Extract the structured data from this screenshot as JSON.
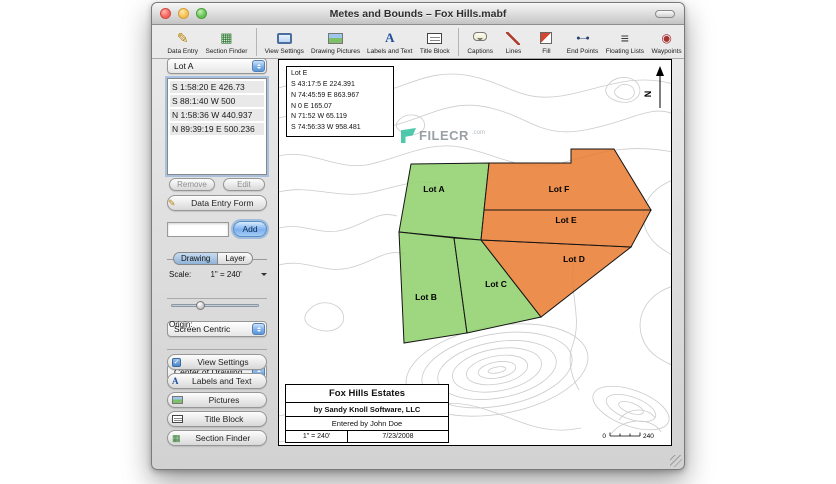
{
  "window": {
    "title": "Metes and Bounds – Fox Hills.mabf"
  },
  "toolbar": {
    "items": [
      {
        "label": "Data Entry",
        "icon": "pencil-icon"
      },
      {
        "label": "Section Finder",
        "icon": "grid-icon"
      },
      {
        "label": "View Settings",
        "icon": "monitor-icon"
      },
      {
        "label": "Drawing Pictures",
        "icon": "picture-icon"
      },
      {
        "label": "Labels and Text",
        "icon": "letter-a-icon"
      },
      {
        "label": "Title Block",
        "icon": "title-block-icon"
      },
      {
        "label": "Captions",
        "icon": "speech-bubble-icon"
      },
      {
        "label": "Lines",
        "icon": "diagonal-line-icon"
      },
      {
        "label": "Fill",
        "icon": "fill-icon"
      },
      {
        "label": "End Points",
        "icon": "end-points-icon"
      },
      {
        "label": "Floating Lists",
        "icon": "list-icon"
      },
      {
        "label": "Waypoints",
        "icon": "waypoint-icon"
      }
    ]
  },
  "sidebar": {
    "lot_popup_value": "Lot A",
    "calls": [
      "S 1:58:20 E 426.73",
      "S 88:1:40 W 500",
      "N 1:58:36 W 440.937",
      "N 89:39:19 E 500.236"
    ],
    "remove_label": "Remove",
    "edit_label": "Edit",
    "data_entry_form_label": "Data Entry Form",
    "add_input_value": "",
    "add_label": "Add",
    "tabs": [
      "Drawing",
      "Layer"
    ],
    "scale_label": "Scale:",
    "scale_value": "1\" = 240'",
    "view_popup_value": "Screen Centric",
    "origin_label": "Origin:",
    "origin_popup_value": "Center of Drawing",
    "panel_buttons": [
      "View Settings",
      "Labels and Text",
      "Pictures",
      "Title Block",
      "Section Finder"
    ]
  },
  "canvas": {
    "info_box": {
      "title": "Lot E",
      "lines": [
        "S 43:17:5 E 224.391",
        "N 74:45:59 E 863.967",
        "N 0 E 165.07",
        "N 71:52 W 65.119",
        "S 74:56:33 W 958.481"
      ]
    },
    "watermark": {
      "name": "FILECR",
      "suffix": ".com"
    },
    "north_label": "N",
    "lots": [
      {
        "name": "Lot A",
        "fill": "#8bcf67"
      },
      {
        "name": "Lot B",
        "fill": "#8bcf67"
      },
      {
        "name": "Lot C",
        "fill": "#8bcf67"
      },
      {
        "name": "Lot D",
        "fill": "#e8782c"
      },
      {
        "name": "Lot E",
        "fill": "#e8782c"
      },
      {
        "name": "Lot F",
        "fill": "#e8782c"
      }
    ],
    "title_block": {
      "title": "Fox Hills Estates",
      "line2": "by Sandy Knoll Software, LLC",
      "line3": "Entered by John Doe",
      "scale": "1\" = 240'",
      "date": "7/23/2008"
    },
    "scale_bar": {
      "start": "0",
      "end": "240"
    }
  },
  "colors": {
    "lot_green": "#8bcf67",
    "lot_orange": "#e8782c",
    "aqua_accent": "#7cb0ee"
  }
}
